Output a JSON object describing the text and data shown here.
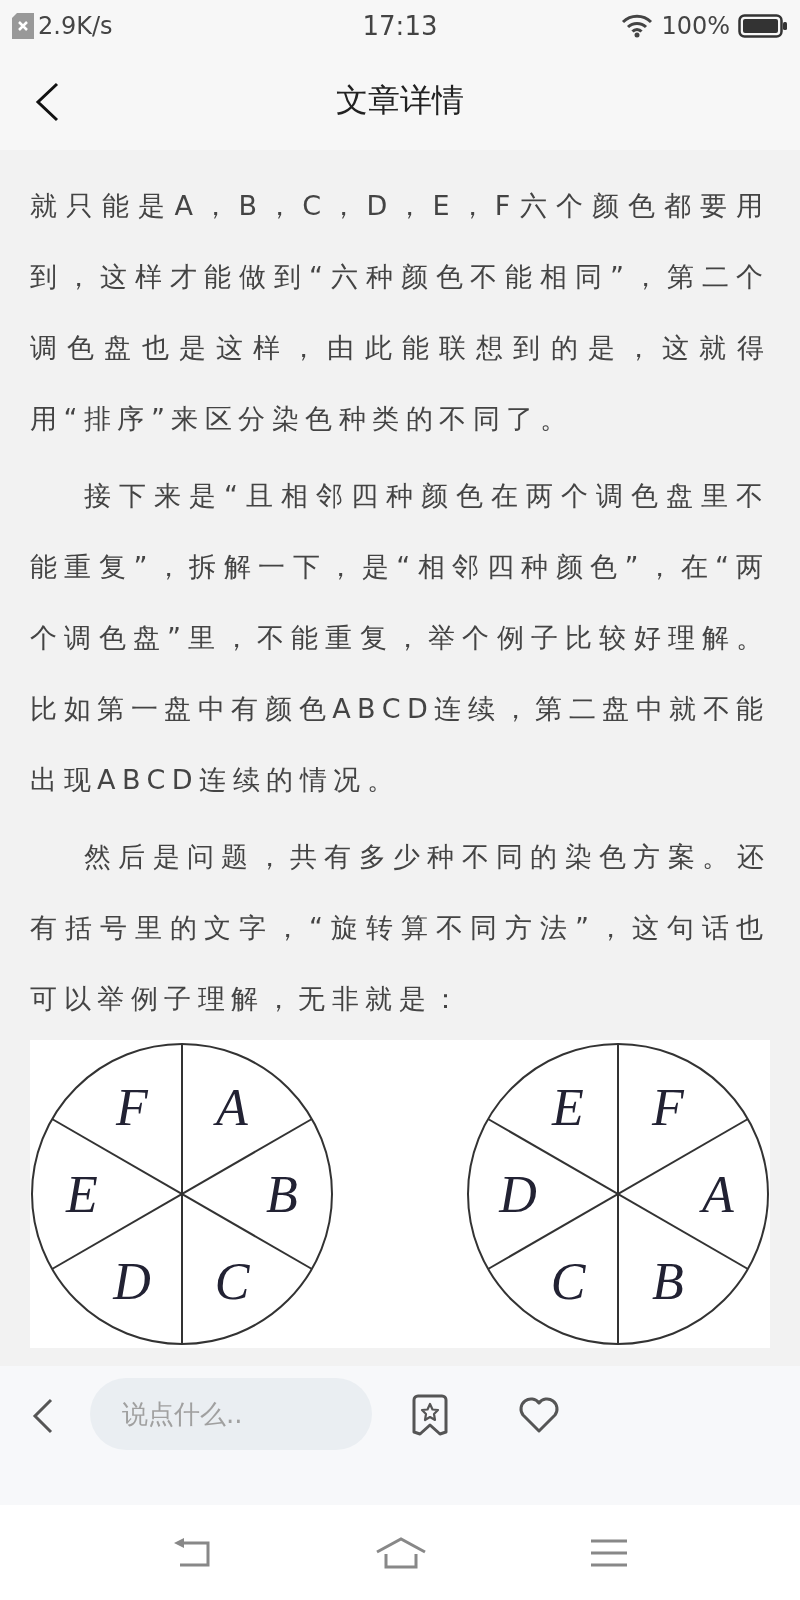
{
  "status_bar": {
    "speed": "2.9K/s",
    "time": "17:13",
    "battery": "100%"
  },
  "header": {
    "title": "文章详情"
  },
  "article": {
    "paragraphs": [
      {
        "text": "就只能是A，B，C，D，E，F六个颜色都要用到，这样才能做到“六种颜色不能相同”，第二个调色盘也是这样，由此能联想到的是，这就得用“排序”来区分染色种类的不同了。",
        "indent": false
      },
      {
        "text": "接下来是“且相邻四种颜色在两个调色盘里不能重复”，拆解一下，是“相邻四种颜色”，在“两个调色盘”里，不能重复，举个例子比较好理解。比如第一盘中有颜色ABCD连续，第二盘中就不能出现ABCD连续的情况。",
        "indent": true
      },
      {
        "text": "然后是问题，共有多少种不同的染色方案。还有括号里的文字，“旋转算不同方法”，这句话也可以举例子理解，无非就是：",
        "indent": true
      }
    ],
    "figure": {
      "wheels": [
        {
          "sectors": [
            "F",
            "A",
            "B",
            "C",
            "D",
            "E"
          ]
        },
        {
          "sectors": [
            "E",
            "F",
            "A",
            "B",
            "C",
            "D"
          ]
        }
      ]
    }
  },
  "comment_bar": {
    "placeholder": "说点什么.."
  }
}
